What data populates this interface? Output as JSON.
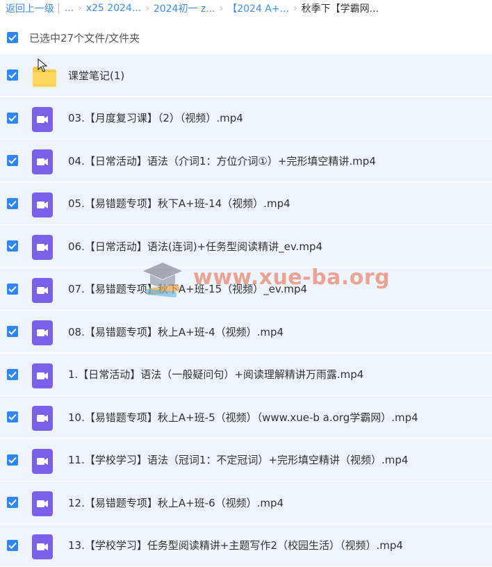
{
  "breadcrumb": {
    "back": "返回上一级",
    "bar": "|",
    "dots": "...",
    "items": [
      "x25 2024...",
      "2024初一 z...",
      "【2024 A+...",
      "秋季下【学霸网..."
    ]
  },
  "selection": {
    "label": "已选中27个文件/文件夹",
    "checked": true
  },
  "watermark": {
    "text": "www.xue-ba.org"
  },
  "accent_color": "#2f86f6",
  "files": [
    {
      "name": "课堂笔记(1)",
      "type": "folder",
      "icon": "folder-icon",
      "checked": true
    },
    {
      "name": "03.【月度复习课】（2）（视频）.mp4",
      "type": "video",
      "icon": "video-icon",
      "checked": true
    },
    {
      "name": "04.【日常活动】语法（介词1：方位介词①）+完形填空精讲.mp4",
      "type": "video",
      "icon": "video-icon",
      "checked": true
    },
    {
      "name": "05.【易错题专项】秋下A+班-14（视频）.mp4",
      "type": "video",
      "icon": "video-icon",
      "checked": true
    },
    {
      "name": "06.【日常活动】语法(连词)+任务型阅读精讲_ev.mp4",
      "type": "video",
      "icon": "video-icon",
      "checked": true
    },
    {
      "name": "07.【易错题专项】秋下A+班-15（视频）_ev.mp4",
      "type": "video",
      "icon": "video-icon",
      "checked": true
    },
    {
      "name": "08.【易错题专项】秋上A+班-4（视频）.mp4",
      "type": "video",
      "icon": "video-icon",
      "checked": true
    },
    {
      "name": "1.【日常活动】语法（一般疑问句）+阅读理解精讲万雨露.mp4",
      "type": "video",
      "icon": "video-icon",
      "checked": true
    },
    {
      "name": "10.【易错题专项】秋上A+班-5（视频）（www.xue-b a.org学霸网）.mp4",
      "type": "video",
      "icon": "video-icon",
      "checked": true
    },
    {
      "name": "11.【学校学习】语法（冠词1：不定冠词）+完形填空精讲（视频）.mp4",
      "type": "video",
      "icon": "video-icon",
      "checked": true
    },
    {
      "name": "12.【易错题专项】秋上A+班-6（视频）.mp4",
      "type": "video",
      "icon": "video-icon",
      "checked": true
    },
    {
      "name": "13.【学校学习】任务型阅读精讲+主题写作2（校园生活）（视频）.mp4",
      "type": "video",
      "icon": "video-icon",
      "checked": true
    }
  ]
}
